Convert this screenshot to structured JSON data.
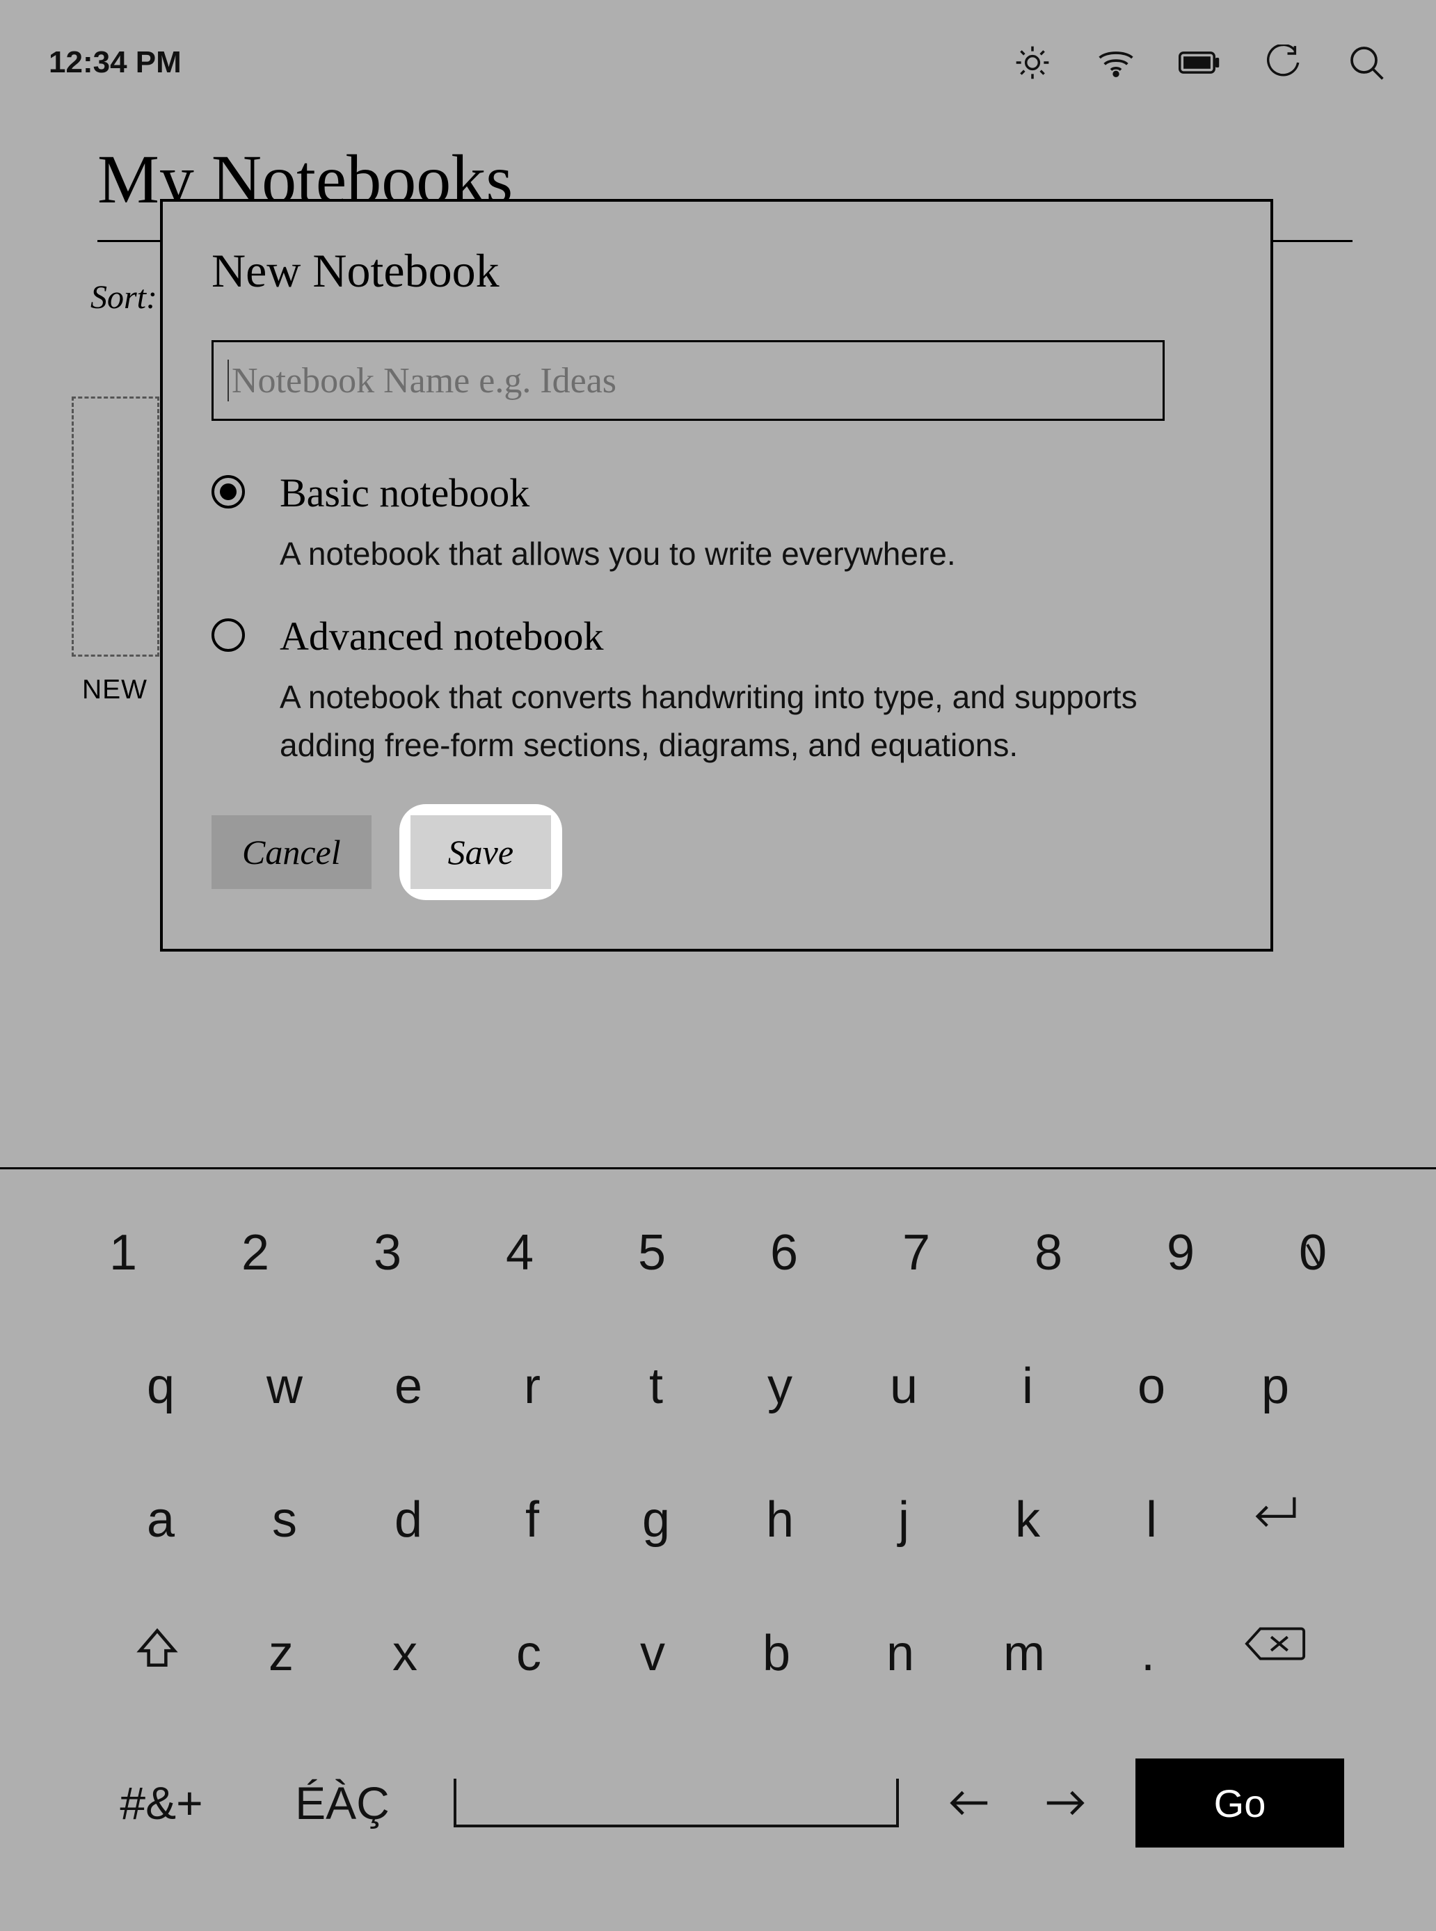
{
  "status": {
    "time": "12:34 PM",
    "icons": [
      "brightness-icon",
      "wifi-icon",
      "battery-icon",
      "refresh-icon",
      "search-icon"
    ]
  },
  "page": {
    "title": "My Notebooks",
    "sort_label": "Sort:",
    "new_tile_label": "NEW"
  },
  "modal": {
    "title": "New Notebook",
    "name_value": "",
    "name_placeholder": "Notebook Name e.g. Ideas",
    "options": [
      {
        "id": "basic",
        "label": "Basic notebook",
        "description": "A notebook that allows you to write everywhere.",
        "selected": true
      },
      {
        "id": "advanced",
        "label": "Advanced notebook",
        "description": "A notebook that converts handwriting into type, and supports adding free-form sections, diagrams, and equations.",
        "selected": false
      }
    ],
    "cancel_label": "Cancel",
    "save_label": "Save"
  },
  "keyboard": {
    "row1": [
      "1",
      "2",
      "3",
      "4",
      "5",
      "6",
      "7",
      "8",
      "9",
      "0"
    ],
    "row2": [
      "q",
      "w",
      "e",
      "r",
      "t",
      "y",
      "u",
      "i",
      "o",
      "p"
    ],
    "row3": [
      "a",
      "s",
      "d",
      "f",
      "g",
      "h",
      "j",
      "k",
      "l"
    ],
    "row4": [
      "z",
      "x",
      "c",
      "v",
      "b",
      "n",
      "m",
      "."
    ],
    "symbols_key": "#&+",
    "accents_key": "ÉÀÇ",
    "go_label": "Go"
  }
}
